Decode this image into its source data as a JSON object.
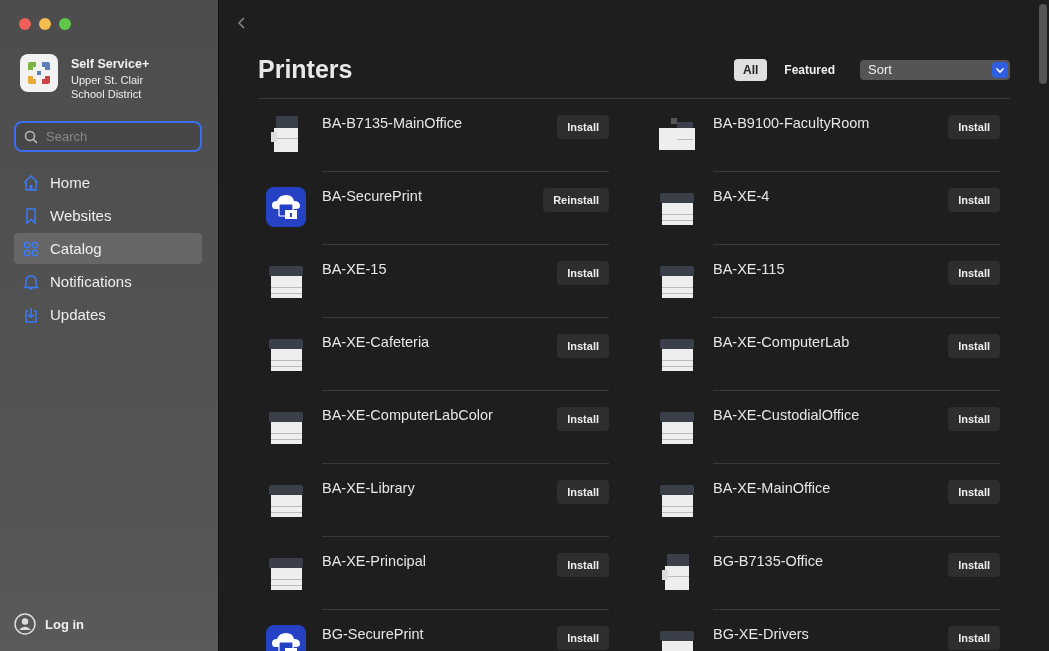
{
  "sidebar": {
    "app_name": "Self Service+",
    "organization": "Upper St. Clair School District",
    "search": {
      "placeholder": "Search"
    },
    "items": [
      {
        "label": "Home",
        "kind": "home",
        "selected": false
      },
      {
        "label": "Websites",
        "kind": "bookmark",
        "selected": false
      },
      {
        "label": "Catalog",
        "kind": "grid",
        "selected": true
      },
      {
        "label": "Notifications",
        "kind": "bell",
        "selected": false
      },
      {
        "label": "Updates",
        "kind": "download",
        "selected": false
      }
    ],
    "login": "Log in"
  },
  "main": {
    "title": "Printers",
    "filters": [
      {
        "label": "All",
        "selected": true
      },
      {
        "label": "Featured",
        "selected": false
      }
    ],
    "sort": "Sort",
    "items": [
      {
        "name": "BA-B7135-MainOffice",
        "kind": "tall",
        "action": "Install"
      },
      {
        "name": "BA-B9100-FacultyRoom",
        "kind": "wide",
        "action": "Install"
      },
      {
        "name": "BA-SecurePrint",
        "kind": "cloud",
        "action": "Reinstall"
      },
      {
        "name": "BA-XE-4",
        "kind": "desktop",
        "action": "Install"
      },
      {
        "name": "BA-XE-15",
        "kind": "desktop",
        "action": "Install"
      },
      {
        "name": "BA-XE-115",
        "kind": "desktop",
        "action": "Install"
      },
      {
        "name": "BA-XE-Cafeteria",
        "kind": "desktop",
        "action": "Install"
      },
      {
        "name": "BA-XE-ComputerLab",
        "kind": "desktop",
        "action": "Install"
      },
      {
        "name": "BA-XE-ComputerLabColor",
        "kind": "desktop",
        "action": "Install"
      },
      {
        "name": "BA-XE-CustodialOffice",
        "kind": "desktop",
        "action": "Install"
      },
      {
        "name": "BA-XE-Library",
        "kind": "desktop",
        "action": "Install"
      },
      {
        "name": "BA-XE-MainOffice",
        "kind": "desktop",
        "action": "Install"
      },
      {
        "name": "BA-XE-Principal",
        "kind": "desktop",
        "action": "Install"
      },
      {
        "name": "BG-B7135-Office",
        "kind": "tall",
        "action": "Install"
      },
      {
        "name": "BG-SecurePrint",
        "kind": "cloud",
        "action": "Install"
      },
      {
        "name": "BG-XE-Drivers",
        "kind": "desktop",
        "action": "Install"
      }
    ]
  }
}
